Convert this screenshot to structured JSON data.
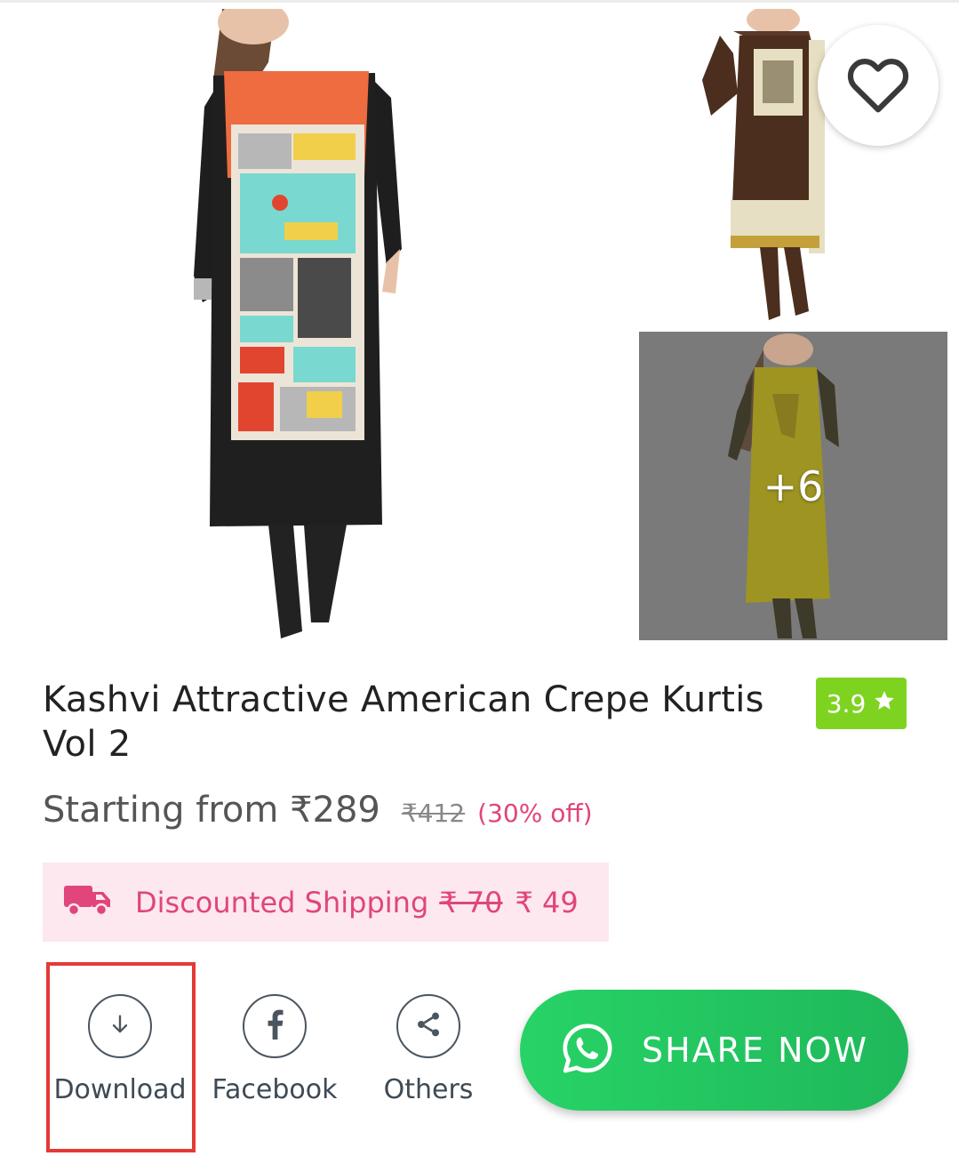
{
  "product": {
    "title": "Kashvi Attractive American Crepe Kurtis Vol 2",
    "rating": "3.9",
    "more_images": "+6"
  },
  "price": {
    "starting_from": "Starting from ₹289",
    "original": "₹412",
    "discount": "(30% off)"
  },
  "shipping": {
    "label": "Discounted Shipping",
    "old_price": "₹ 70",
    "new_price": "₹ 49"
  },
  "share_options": {
    "download": "Download",
    "facebook": "Facebook",
    "others": "Others"
  },
  "share_now": {
    "label": "SHARE NOW"
  },
  "icons": {
    "wishlist": "heart-outline-icon",
    "rating": "star-icon",
    "shipping": "truck-icon",
    "download": "download-arrow-icon",
    "facebook": "facebook-icon",
    "others": "share-icon",
    "share_now": "whatsapp-icon"
  },
  "colors": {
    "accent_pink": "#e0457b",
    "shipping_bg": "#fde8ef",
    "rating_green": "#7ed321",
    "whatsapp_green": "#25d366",
    "highlight_red": "#e53935"
  }
}
